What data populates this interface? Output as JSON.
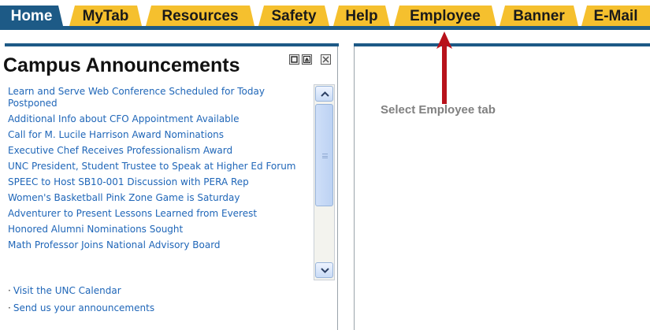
{
  "tabs": [
    {
      "label": "Home",
      "active": true
    },
    {
      "label": "MyTab",
      "active": false
    },
    {
      "label": "Resources",
      "active": false
    },
    {
      "label": "Safety",
      "active": false
    },
    {
      "label": "Help",
      "active": false
    },
    {
      "label": "Employee",
      "active": false
    },
    {
      "label": "Banner",
      "active": false
    },
    {
      "label": "E-Mail",
      "active": false
    }
  ],
  "colors": {
    "tab_fill": "#f5c02e",
    "active_tab_fill": "#1d5a86",
    "link": "#1f66b8",
    "annotation_arrow": "#b8121b"
  },
  "portlet": {
    "title": "Campus Announcements",
    "controls": [
      "maximize-icon",
      "restore-icon",
      "close-icon"
    ],
    "announcements": [
      "Learn and Serve Web Conference Scheduled for Today Postponed",
      "Additional Info about CFO Appointment Available",
      "Call for M. Lucile Harrison Award Nominations",
      "Executive Chef Receives Professionalism Award",
      "UNC President, Student Trustee to Speak at Higher Ed Forum",
      "SPEEC to Host SB10-001 Discussion with PERA Rep",
      "Women's Basketball Pink Zone Game is Saturday",
      "Adventurer to Present Lessons Learned from Everest",
      "Honored Alumni Nominations Sought",
      "Math Professor Joins National Advisory Board"
    ],
    "links": [
      "Visit the UNC Calendar",
      "Send us your announcements"
    ]
  },
  "annotation": {
    "text": "Select Employee tab"
  }
}
